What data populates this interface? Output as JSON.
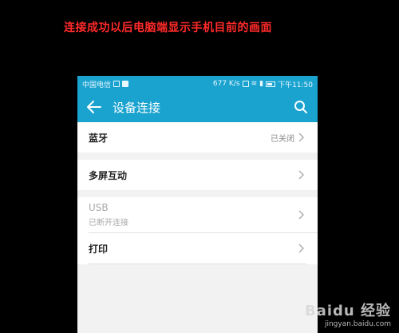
{
  "caption": "连接成功以后电脑端显示手机目前的画面",
  "statusbar": {
    "carrier": "中国电信 ",
    "speed": "677 K/s",
    "time": "下午11:50"
  },
  "appbar": {
    "title": "设备连接"
  },
  "items": {
    "bluetooth": {
      "label": "蓝牙",
      "value": "已关闭"
    },
    "multiscreen": {
      "label": "多屏互动"
    },
    "usb": {
      "label": "USB",
      "sub": "已断开连接"
    },
    "print": {
      "label": "打印"
    }
  },
  "watermark": {
    "brand": "Baidu 经验",
    "url": "jingyan.baidu.com"
  }
}
